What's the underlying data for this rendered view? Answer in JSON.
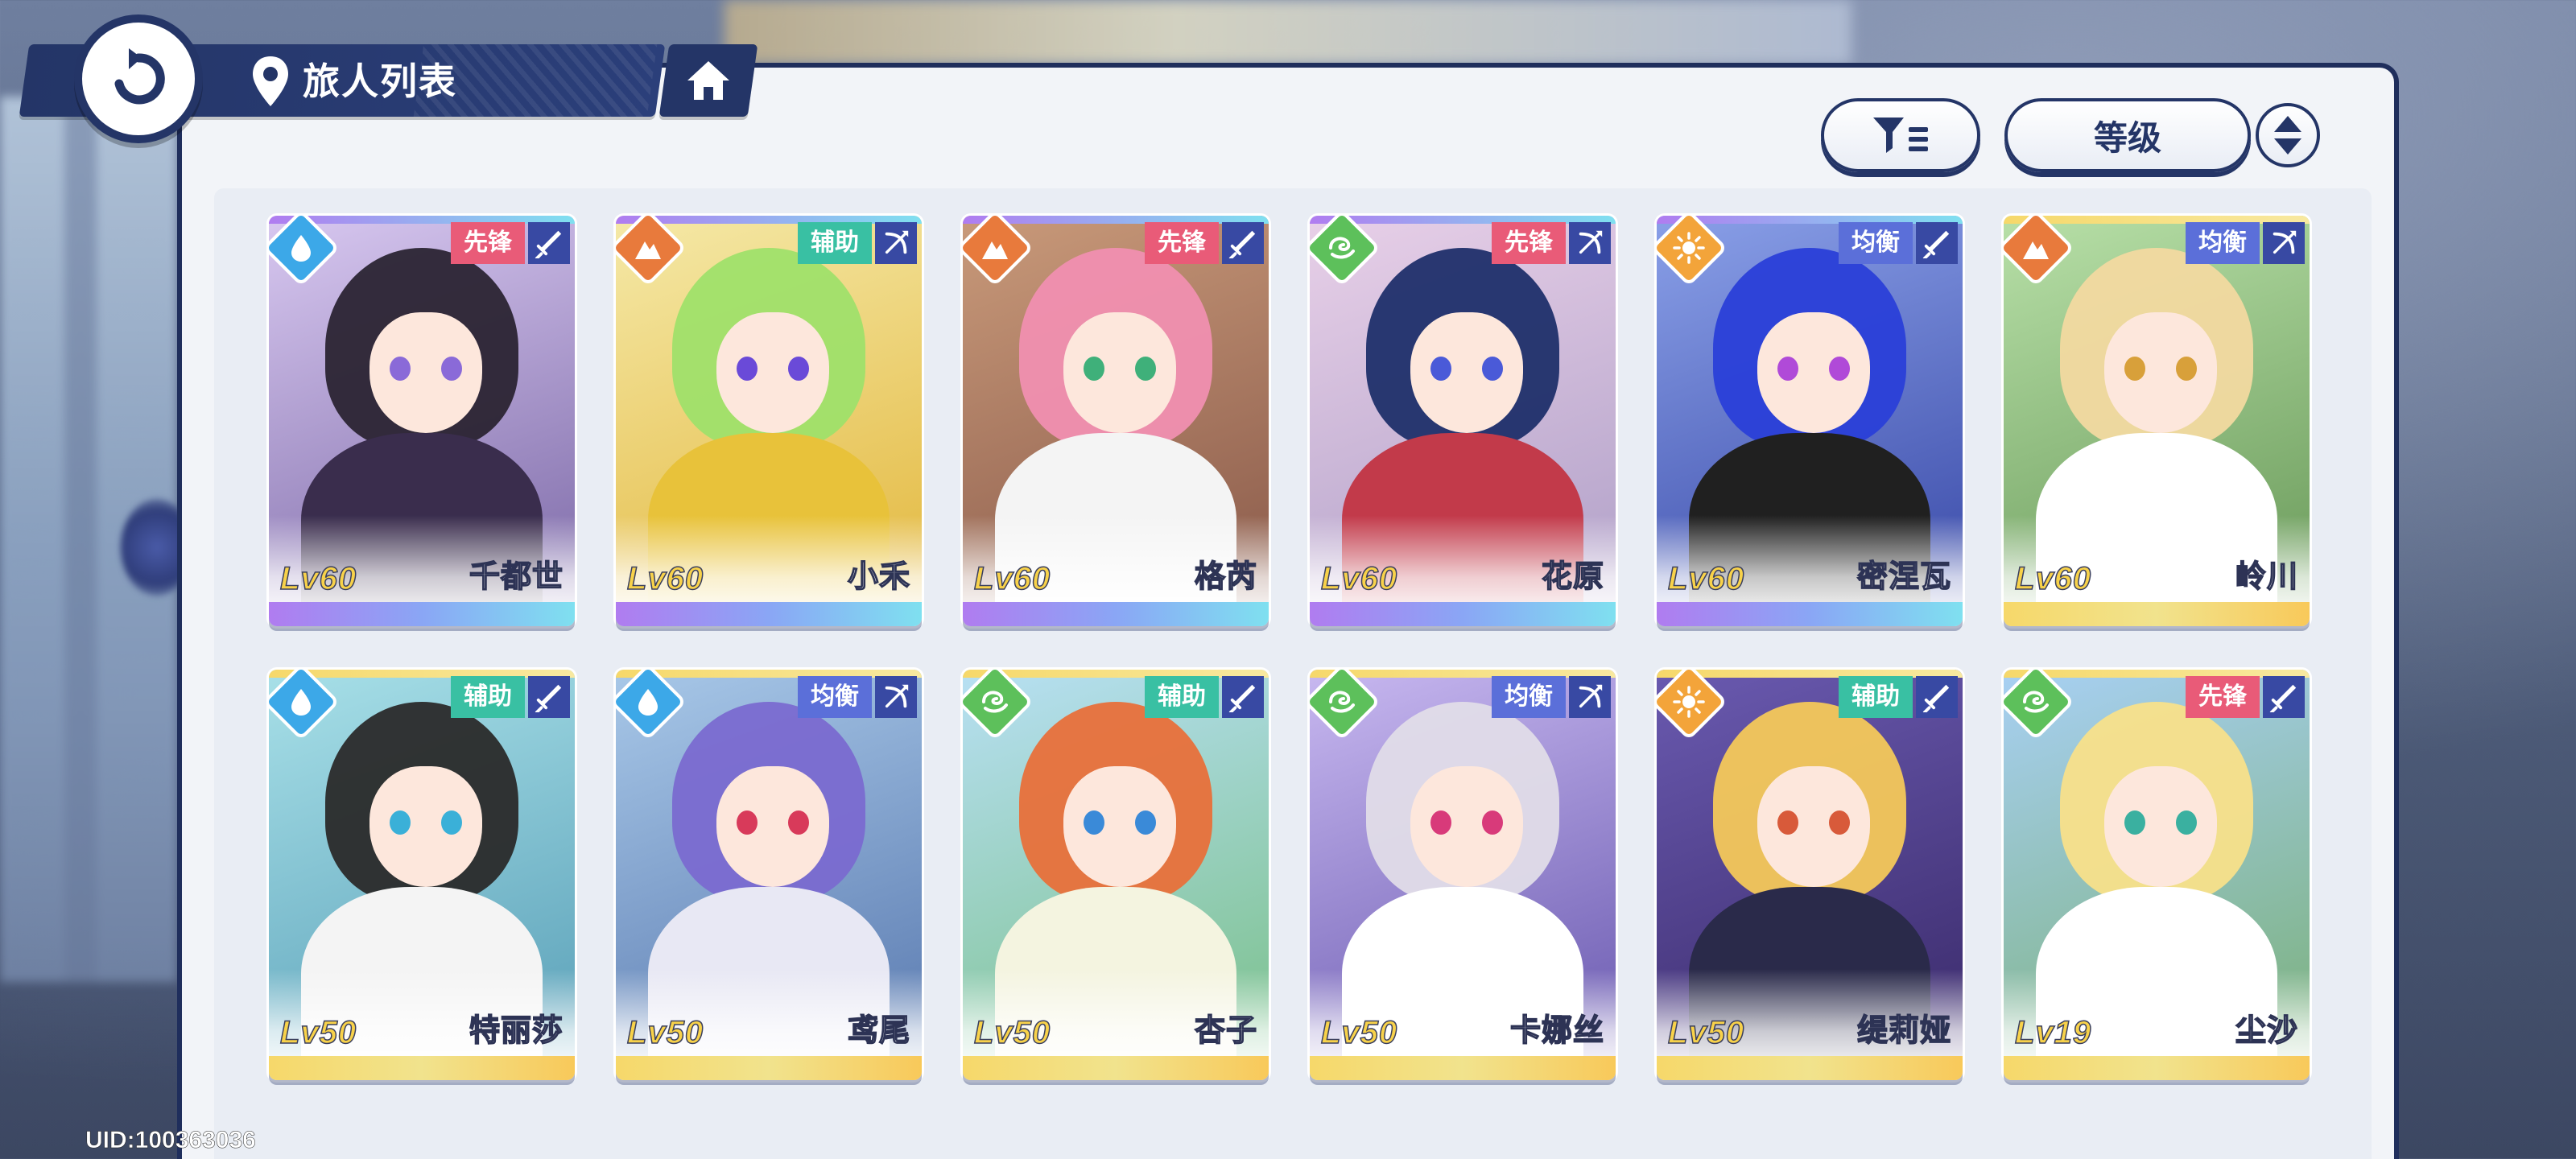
{
  "header": {
    "title": "旅人列表"
  },
  "toolbar": {
    "sort_label": "等级"
  },
  "uid": "UID:100363036",
  "colors": {
    "navy": "#243567",
    "vanguard": "#e95b78",
    "support": "#39c0a3",
    "balance": "#5b6fd9"
  },
  "characters": [
    {
      "name": "千都世",
      "level": "Lv60",
      "role": "先锋",
      "element": "water-icon",
      "weapon": "sword-icon",
      "rarity": "purple"
    },
    {
      "name": "小禾",
      "level": "Lv60",
      "role": "辅助",
      "element": "earth-icon",
      "weapon": "bow-icon",
      "rarity": "purple"
    },
    {
      "name": "格芮",
      "level": "Lv60",
      "role": "先锋",
      "element": "earth-icon",
      "weapon": "sword-icon",
      "rarity": "purple"
    },
    {
      "name": "花原",
      "level": "Lv60",
      "role": "先锋",
      "element": "wind-icon",
      "weapon": "bow-icon",
      "rarity": "purple"
    },
    {
      "name": "密涅瓦",
      "level": "Lv60",
      "role": "均衡",
      "element": "light-icon",
      "weapon": "sword-icon",
      "rarity": "purple"
    },
    {
      "name": "岭川",
      "level": "Lv60",
      "role": "均衡",
      "element": "earth-icon",
      "weapon": "bow-icon",
      "rarity": "gold"
    },
    {
      "name": "特丽莎",
      "level": "Lv50",
      "role": "辅助",
      "element": "water-icon",
      "weapon": "sword-icon",
      "rarity": "gold"
    },
    {
      "name": "鸢尾",
      "level": "Lv50",
      "role": "均衡",
      "element": "water-icon",
      "weapon": "bow-icon",
      "rarity": "gold"
    },
    {
      "name": "杏子",
      "level": "Lv50",
      "role": "辅助",
      "element": "wind-icon",
      "weapon": "sword-icon",
      "rarity": "gold"
    },
    {
      "name": "卡娜丝",
      "level": "Lv50",
      "role": "均衡",
      "element": "wind-icon",
      "weapon": "bow-icon",
      "rarity": "gold"
    },
    {
      "name": "缇莉娅",
      "level": "Lv50",
      "role": "辅助",
      "element": "light-icon",
      "weapon": "sword-icon",
      "rarity": "gold"
    },
    {
      "name": "尘沙",
      "level": "Lv19",
      "role": "先锋",
      "element": "wind-icon",
      "weapon": "sword-icon",
      "rarity": "gold"
    }
  ]
}
